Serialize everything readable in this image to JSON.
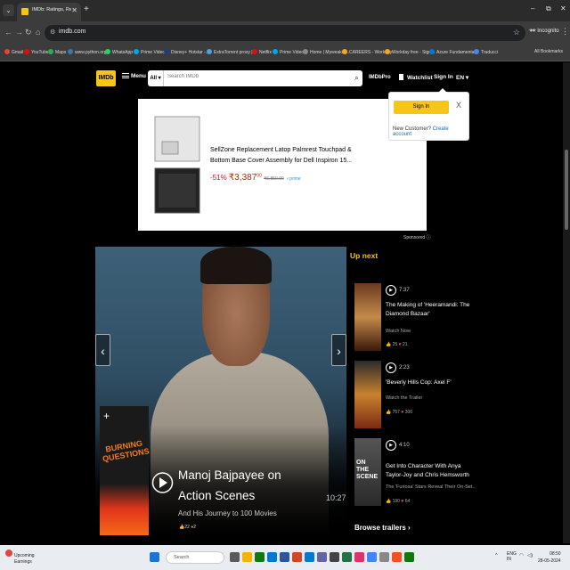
{
  "browser": {
    "tab_title": "IMDb: Ratings, Reviews, and Wh",
    "url": "imdb.com",
    "incognito_label": "Incognito",
    "bookmarks": [
      "Gmail",
      "YouTube",
      "Maps",
      "www.python.org",
      "WhatsApp",
      "Prime Video",
      "Disney+ Hotstar -...",
      "ExtraTorrent proxy |...",
      "Netflix",
      "Prime Video",
      "Home | Myweaker...",
      "CAREERS - Workday",
      "Workday free - Sign...",
      "Azure Fundamental...",
      "Traducci"
    ],
    "all_bookmarks": "All Bookmarks"
  },
  "header": {
    "logo": "IMDb",
    "menu": "Menu",
    "search_category": "All",
    "search_placeholder": "Search IMDb",
    "imdbpro": "IMDbPro",
    "watchlist": "Watchlist",
    "signin": "Sign In",
    "language": "EN"
  },
  "signin_popup": {
    "button": "Sign In",
    "close": "X",
    "new_customer": "New Customer?",
    "create_account": "Create account"
  },
  "ad": {
    "title": "SellZone Replacement Latop Palmrest Touchpad & Bottom Base Cover Assembly for Dell Inspiron 15...",
    "discount": "-51%",
    "price": "₹3,387",
    "price_sup": "00",
    "old_price": "₹6,859.00",
    "prime": "✓prime",
    "sponsored": "Sponsored ⓘ"
  },
  "hero": {
    "title": "Manoj Bajpayee on Action Scenes",
    "subtitle": "And His Journey to 100 Movies",
    "duration": "10:27",
    "likes": "22",
    "reactions": "2",
    "poster_text": "BURNING QUESTIONS"
  },
  "up_next": {
    "heading": "Up next",
    "items": [
      {
        "duration": "7:37",
        "title": "The Making of 'Heeramandi: The Diamond Bazaar'",
        "sub": "Watch Now",
        "likes": "25",
        "hearts": "21"
      },
      {
        "duration": "2:23",
        "title": "'Beverly Hills Cop: Axel F'",
        "sub": "Watch the Trailer",
        "likes": "757",
        "hearts": "306"
      },
      {
        "duration": "4:10",
        "title": "Get Into Character With Anya Taylor-Joy and Chris Hemsworth",
        "sub": "The 'Furiosa' Stars Reveal Their On-Set...",
        "likes": "190",
        "hearts": "64"
      }
    ],
    "browse": "Browse trailers ›"
  },
  "taskbar": {
    "weather_title": "Upcoming",
    "weather_sub": "Earnings",
    "search": "Search",
    "lang_top": "ENG",
    "lang_bottom": "IN",
    "time": "08:50",
    "date": "28-05-2024"
  }
}
